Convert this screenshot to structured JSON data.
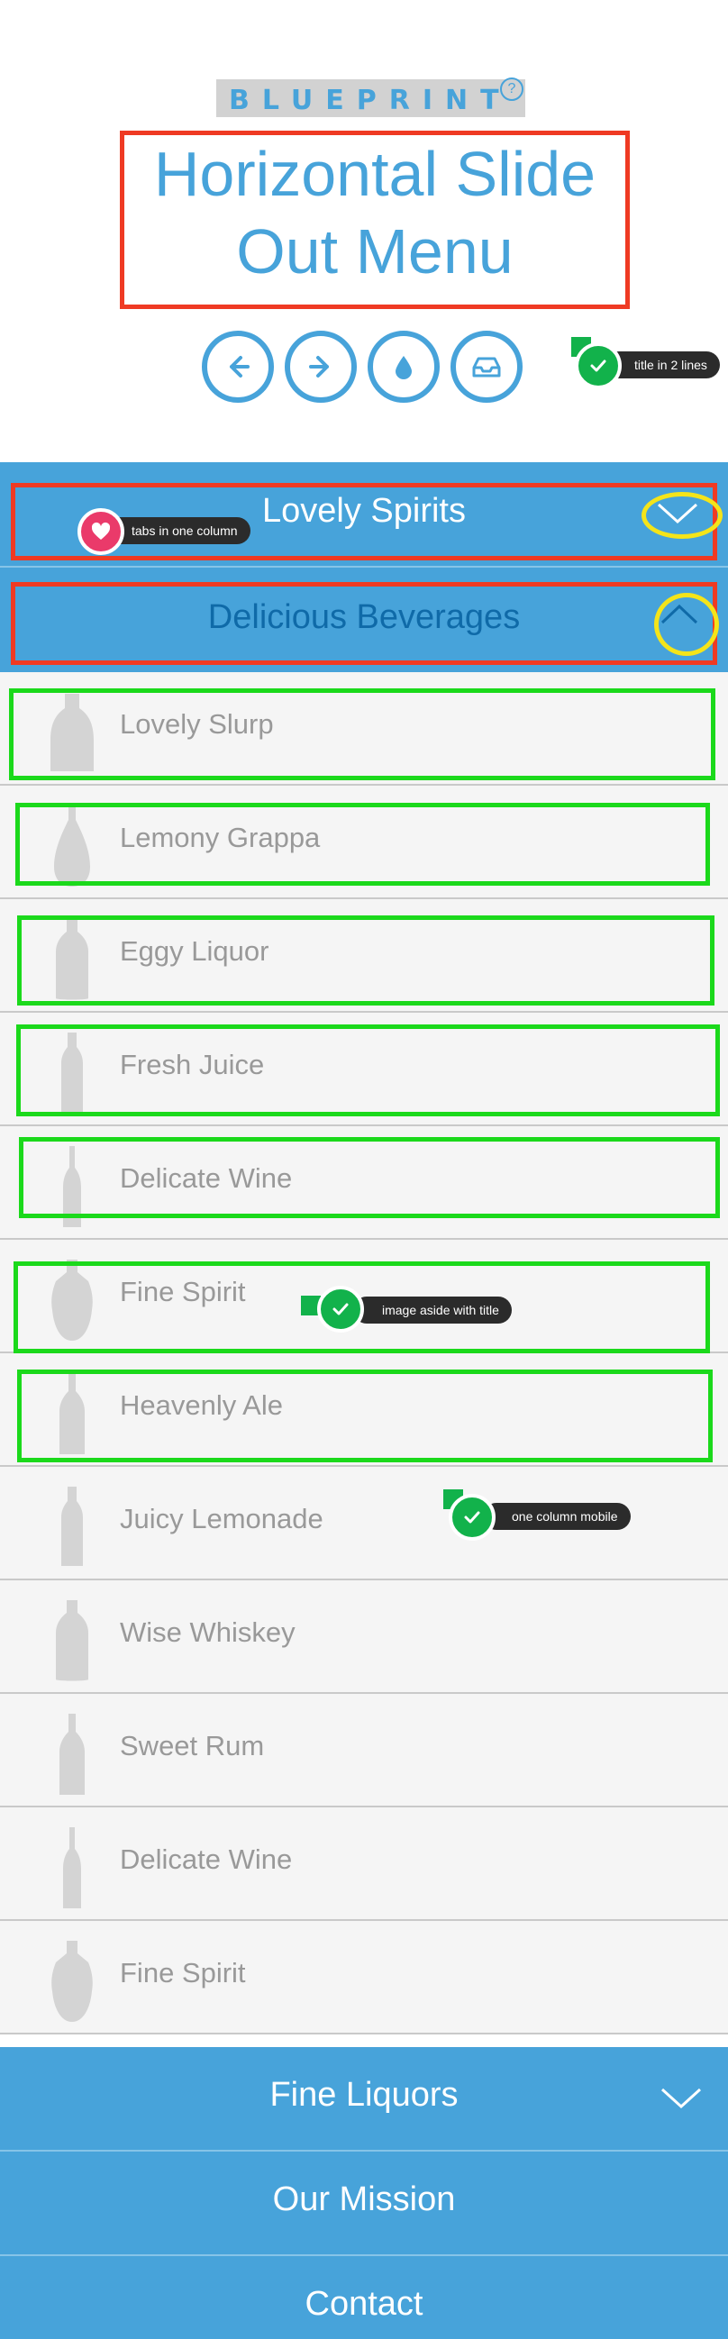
{
  "header": {
    "brand": "BLUEPRINT",
    "help_symbol": "?",
    "title_line1": "Horizontal Slide",
    "title_line2": "Out Menu"
  },
  "nav_buttons": [
    {
      "icon": "arrow-left-icon"
    },
    {
      "icon": "arrow-right-icon"
    },
    {
      "icon": "drop-icon"
    },
    {
      "icon": "inbox-icon"
    }
  ],
  "annotations": {
    "title_note": "title in 2 lines",
    "tabs_note": "tabs in one column",
    "image_note": "image aside with title",
    "mobile_note": "one column mobile"
  },
  "tabs": {
    "spirits": "Lovely Spirits",
    "beverages": "Delicious Beverages",
    "liquors": "Fine Liquors",
    "mission": "Our Mission",
    "contact": "Contact"
  },
  "items": [
    {
      "label": "Lovely Slurp",
      "icon": "round-bottle-icon"
    },
    {
      "label": "Lemony Grappa",
      "icon": "flask-bottle-icon"
    },
    {
      "label": "Eggy Liquor",
      "icon": "liquor-bottle-icon"
    },
    {
      "label": "Fresh Juice",
      "icon": "juice-bottle-icon"
    },
    {
      "label": "Delicate Wine",
      "icon": "wine-bottle-icon"
    },
    {
      "label": "Fine Spirit",
      "icon": "spirit-bottle-icon"
    },
    {
      "label": "Heavenly Ale",
      "icon": "ale-bottle-icon"
    },
    {
      "label": "Juicy Lemonade",
      "icon": "lemonade-bottle-icon"
    },
    {
      "label": "Wise Whiskey",
      "icon": "whiskey-bottle-icon"
    },
    {
      "label": "Sweet Rum",
      "icon": "rum-bottle-icon"
    },
    {
      "label": "Delicate Wine",
      "icon": "wine-bottle-icon"
    },
    {
      "label": "Fine Spirit",
      "icon": "spirit-bottle-icon"
    }
  ],
  "colors": {
    "accent": "#47a3da",
    "active_tab_text": "#0f6aa8",
    "annotation_red": "#ef3a23",
    "annotation_green": "#1bd91b",
    "annotation_yellow": "#f4e41a"
  }
}
